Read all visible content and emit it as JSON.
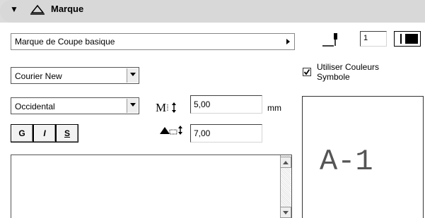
{
  "header": {
    "title": "Marque",
    "icon": "marker-icon",
    "collapse_icon": "collapse-triangle-icon"
  },
  "marker_type": {
    "value": "Marque de Coupe basique"
  },
  "pen": {
    "value": "1",
    "icon": "pen-icon"
  },
  "font": {
    "name": "Courier New",
    "script": "Occidental"
  },
  "style_buttons": {
    "bold": "G",
    "italic": "I",
    "underline": "S"
  },
  "text_size": {
    "value": "5,00",
    "unit": "mm",
    "icon": "text-height-icon"
  },
  "marker_size": {
    "value": "7,00",
    "icon": "marker-size-icon"
  },
  "symbol_colors": {
    "label_line1": "Utiliser Couleurs",
    "label_line2": "Symbole",
    "checked": true
  },
  "preview": {
    "label": "A-1"
  },
  "colors": {
    "header_bg": "#d8d8d8",
    "control_bg": "#f2f2f2"
  }
}
